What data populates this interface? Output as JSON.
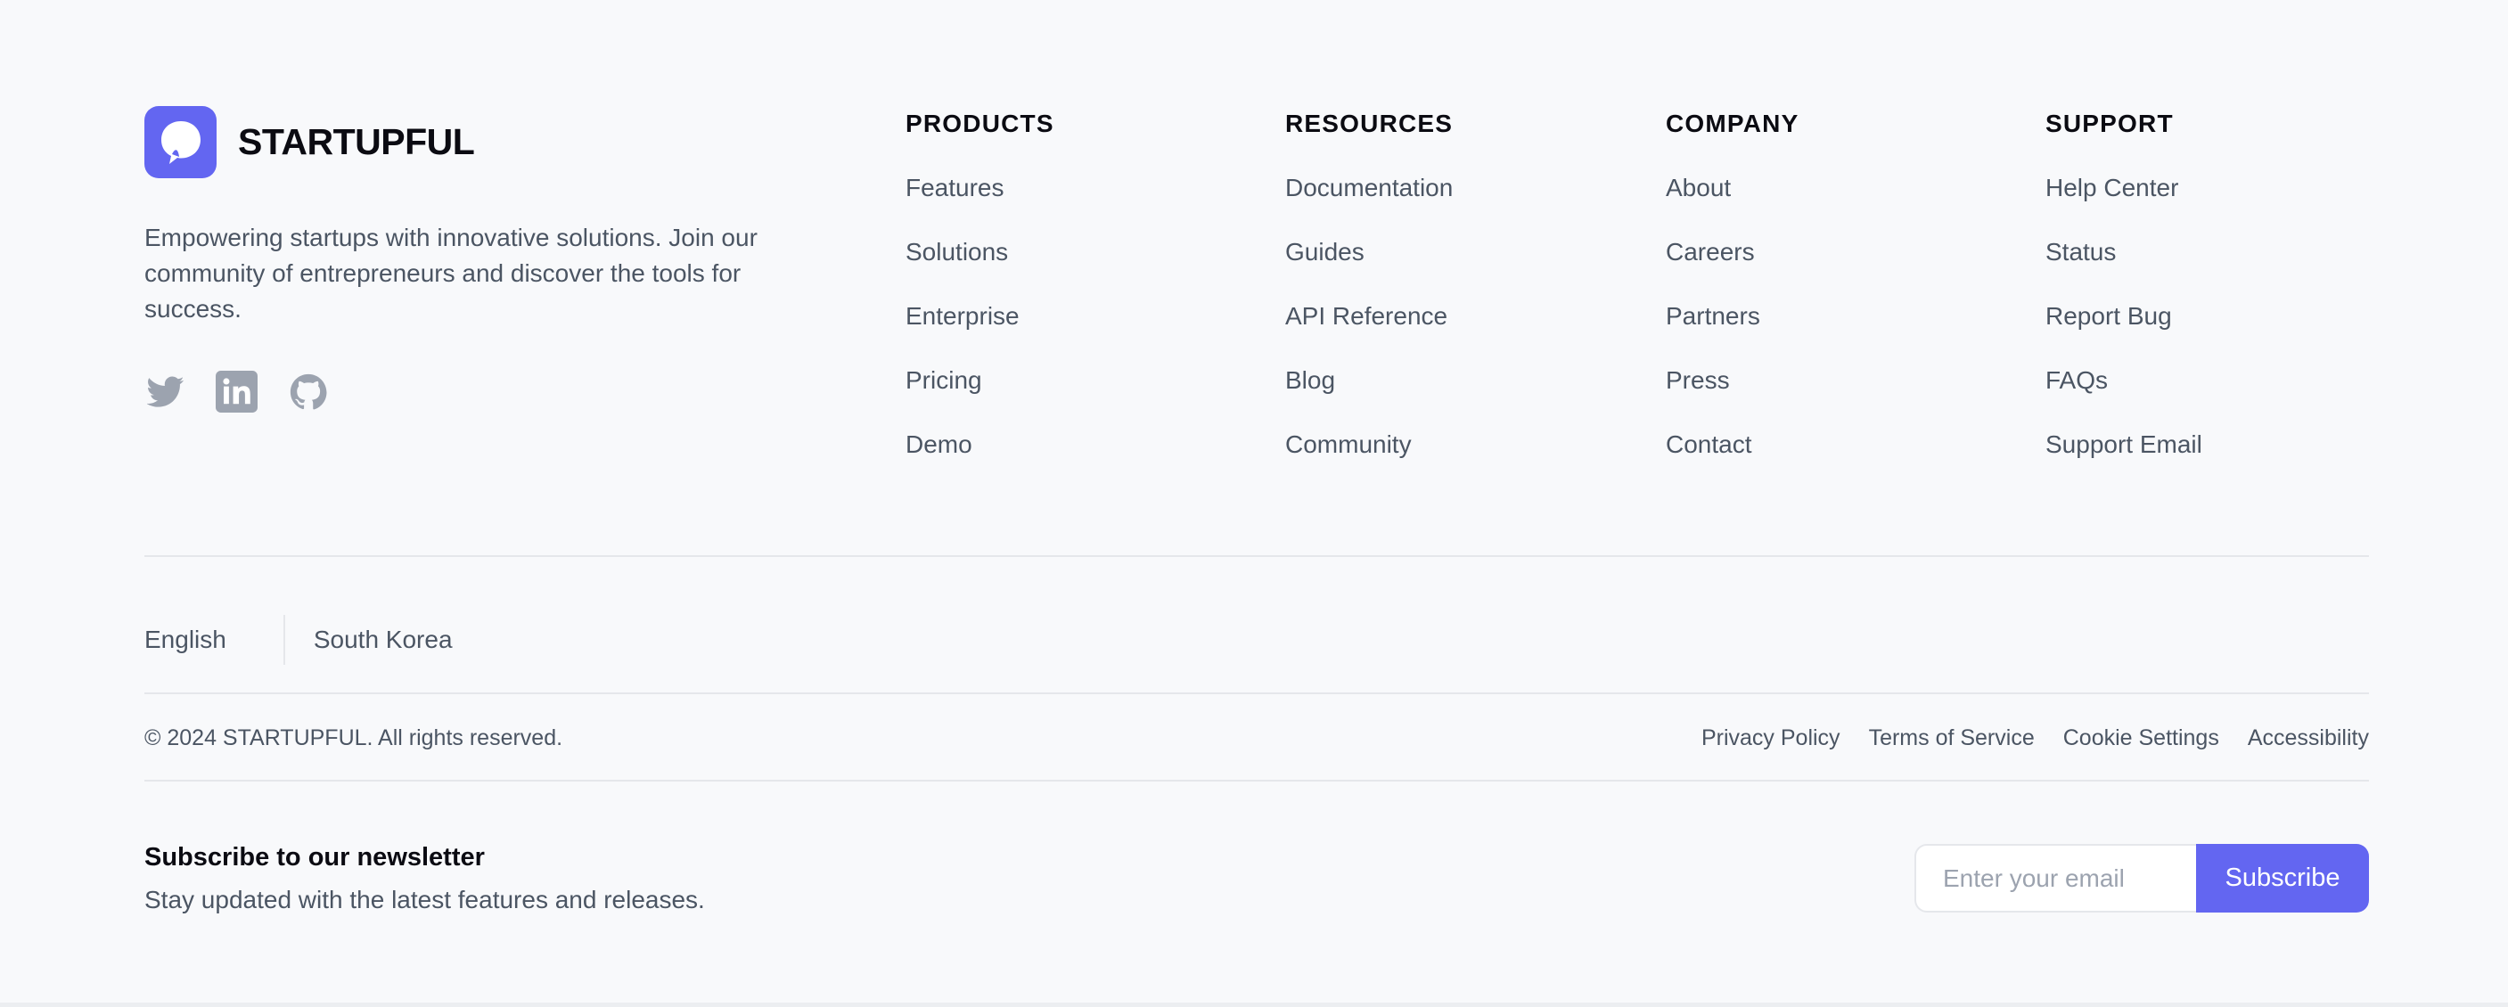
{
  "brand": {
    "name": "STARTUPFUL",
    "description": "Empowering startups with innovative solutions. Join our community of entrepreneurs and discover the tools for success.",
    "logo_icon": "speech-bubble-logo-icon",
    "accent_color": "#6366f1"
  },
  "socials": [
    {
      "icon": "twitter-icon"
    },
    {
      "icon": "linkedin-icon"
    },
    {
      "icon": "github-icon"
    }
  ],
  "columns": [
    {
      "title": "PRODUCTS",
      "links": [
        "Features",
        "Solutions",
        "Enterprise",
        "Pricing",
        "Demo"
      ]
    },
    {
      "title": "RESOURCES",
      "links": [
        "Documentation",
        "Guides",
        "API Reference",
        "Blog",
        "Community"
      ]
    },
    {
      "title": "COMPANY",
      "links": [
        "About",
        "Careers",
        "Partners",
        "Press",
        "Contact"
      ]
    },
    {
      "title": "SUPPORT",
      "links": [
        "Help Center",
        "Status",
        "Report Bug",
        "FAQs",
        "Support Email"
      ]
    }
  ],
  "locale": {
    "language": "English",
    "region": "South Korea"
  },
  "copyright": "© 2024 STARTUPFUL. All rights reserved.",
  "legal_links": [
    "Privacy Policy",
    "Terms of Service",
    "Cookie Settings",
    "Accessibility"
  ],
  "newsletter": {
    "title": "Subscribe to our newsletter",
    "subtitle": "Stay updated with the latest features and releases.",
    "email_placeholder": "Enter your email",
    "email_value": "",
    "button_label": "Subscribe"
  }
}
